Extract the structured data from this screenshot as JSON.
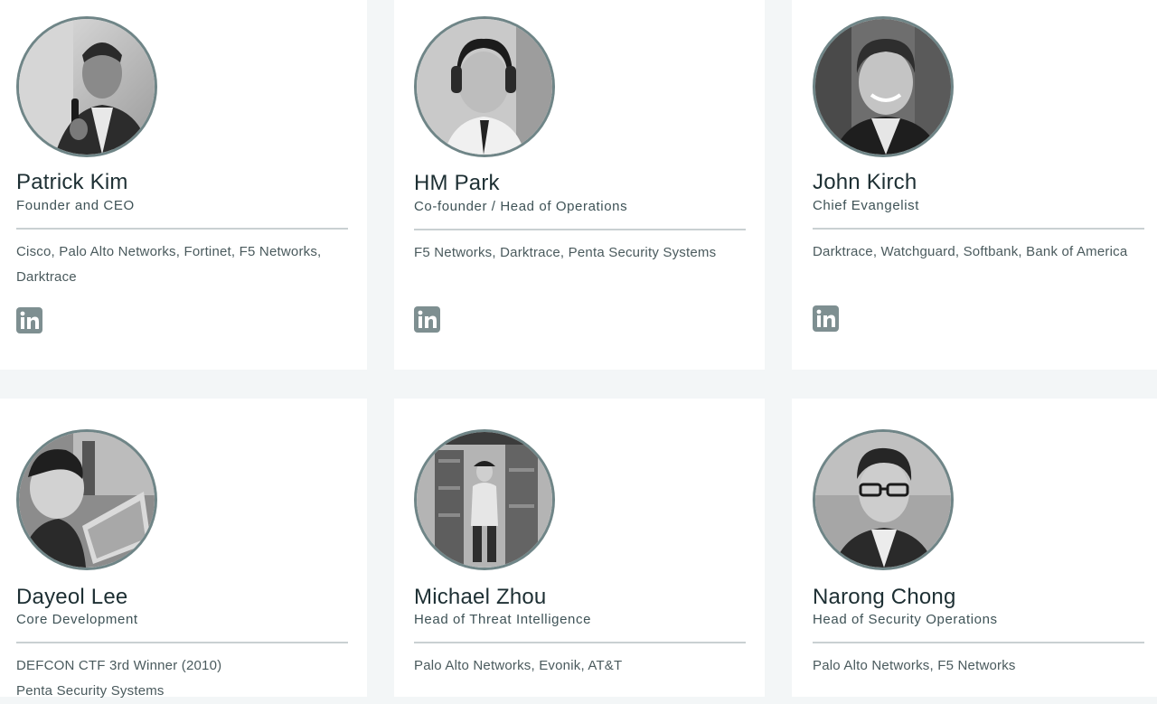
{
  "colors": {
    "background": "#f3f6f7",
    "card": "#ffffff",
    "avatar_ring": "#6f8587",
    "linkedin": "#7e8f91",
    "divider": "#c9d0d2"
  },
  "team": [
    {
      "name": "Patrick Kim",
      "role": "Founder and CEO",
      "bio": [
        "Cisco, Palo Alto Networks, Fortinet, F5 Networks,",
        "Darktrace"
      ],
      "linkedin_icon": "linkedin-icon"
    },
    {
      "name": "HM Park",
      "role": "Co-founder / Head of Operations",
      "bio": [
        "F5 Networks, Darktrace, Penta Security Systems"
      ],
      "linkedin_icon": "linkedin-icon"
    },
    {
      "name": "John Kirch",
      "role": "Chief Evangelist",
      "bio": [
        "Darktrace, Watchguard, Softbank, Bank of America"
      ],
      "linkedin_icon": "linkedin-icon"
    },
    {
      "name": "Dayeol Lee",
      "role": "Core Development",
      "bio": [
        "DEFCON CTF 3rd Winner (2010)",
        "Penta Security Systems"
      ]
    },
    {
      "name": "Michael Zhou",
      "role": "Head of Threat Intelligence",
      "bio": [
        "Palo Alto Networks, Evonik, AT&T"
      ]
    },
    {
      "name": "Narong Chong",
      "role": "Head of Security Operations",
      "bio": [
        "Palo Alto Networks, F5 Networks"
      ]
    }
  ]
}
